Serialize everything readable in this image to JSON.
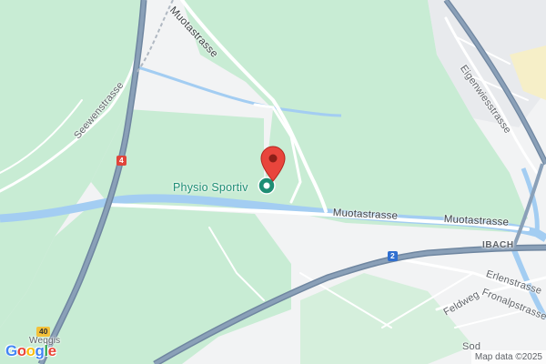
{
  "map": {
    "roads": {
      "muotastrasse_top": "Muotastrasse",
      "muotastrasse_main_1": "Muotastrasse",
      "muotastrasse_main_2": "Muotastrasse",
      "seewenstrasse": "Seewenstrasse",
      "eigenwiesstrasse": "Eigenwiesstrasse",
      "erlenstrasse": "Erlenstrasse",
      "fronalpstrasse": "Fronalpstrasse",
      "feldweg": "Feldweg",
      "sod": "Sod"
    },
    "places": {
      "ibach": "IBACH",
      "weggis": "Weggis"
    },
    "shields": {
      "route_4": "4",
      "route_2": "2",
      "route_40": "40"
    },
    "poi": {
      "name": "Physio Sportiv",
      "pin_icon": "red-location-pin-icon",
      "poi_icon": "medical-poi-icon"
    },
    "branding": {
      "logo_letters": [
        "G",
        "o",
        "o",
        "g",
        "l",
        "e"
      ]
    },
    "attribution": "Map data ©2025",
    "colors": {
      "background": "#f2f3f4",
      "green_area": "#c8ecd4",
      "water": "#a3cdf2",
      "highway": "#8aa0b8",
      "minor_road": "#ffffff",
      "pin": "#e8453c",
      "poi": "#1e8e74"
    }
  }
}
